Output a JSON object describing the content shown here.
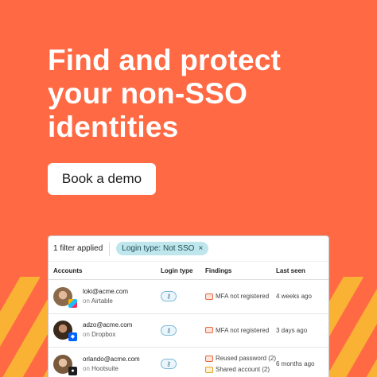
{
  "headline": [
    "Find and protect",
    "your non-SSO",
    "identities"
  ],
  "cta_label": "Book a demo",
  "colors": {
    "background": "#FF6A45",
    "stripe": "#F9B233",
    "chip": "#BFE6EC"
  },
  "filter_bar": {
    "count_label": "1 filter applied",
    "chip_label": "Login type: Not SSO",
    "chip_close": "×"
  },
  "table": {
    "headers": [
      "Accounts",
      "Login type",
      "Findings",
      "Last seen"
    ],
    "rows": [
      {
        "email": "loki@acme.com",
        "on": "on",
        "app": "Airtable",
        "app_icon": "airtable-icon",
        "login_icon": "key-icon",
        "findings": [
          {
            "text": "MFA not registered",
            "severity": "high"
          }
        ],
        "last_seen": "4 weeks ago"
      },
      {
        "email": "adzo@acme.com",
        "on": "on",
        "app": "Dropbox",
        "app_icon": "dropbox-icon",
        "login_icon": "key-icon",
        "findings": [
          {
            "text": "MFA not registered",
            "severity": "high"
          }
        ],
        "last_seen": "3 days ago"
      },
      {
        "email": "orlando@acme.com",
        "on": "on",
        "app": "Hootsuite",
        "app_icon": "hootsuite-icon",
        "login_icon": "key-icon",
        "findings": [
          {
            "text": "Reused password (2)",
            "severity": "high"
          },
          {
            "text": "Shared account (2)",
            "severity": "medium"
          }
        ],
        "last_seen": "6 months ago"
      }
    ]
  }
}
